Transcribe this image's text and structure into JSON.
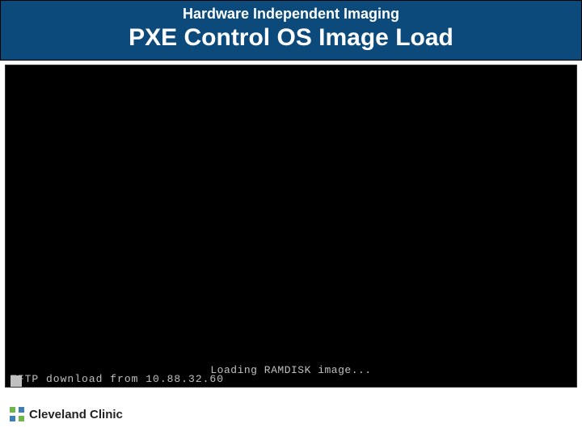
{
  "header": {
    "small": "Hardware Independent Imaging",
    "large": "PXE Control OS Image Load"
  },
  "terminal": {
    "loading_line": "Loading RAMDISK image...",
    "tftp_line": "TFTP download from 10.88.32.60"
  },
  "footer": {
    "brand": "Cleveland Clinic"
  }
}
